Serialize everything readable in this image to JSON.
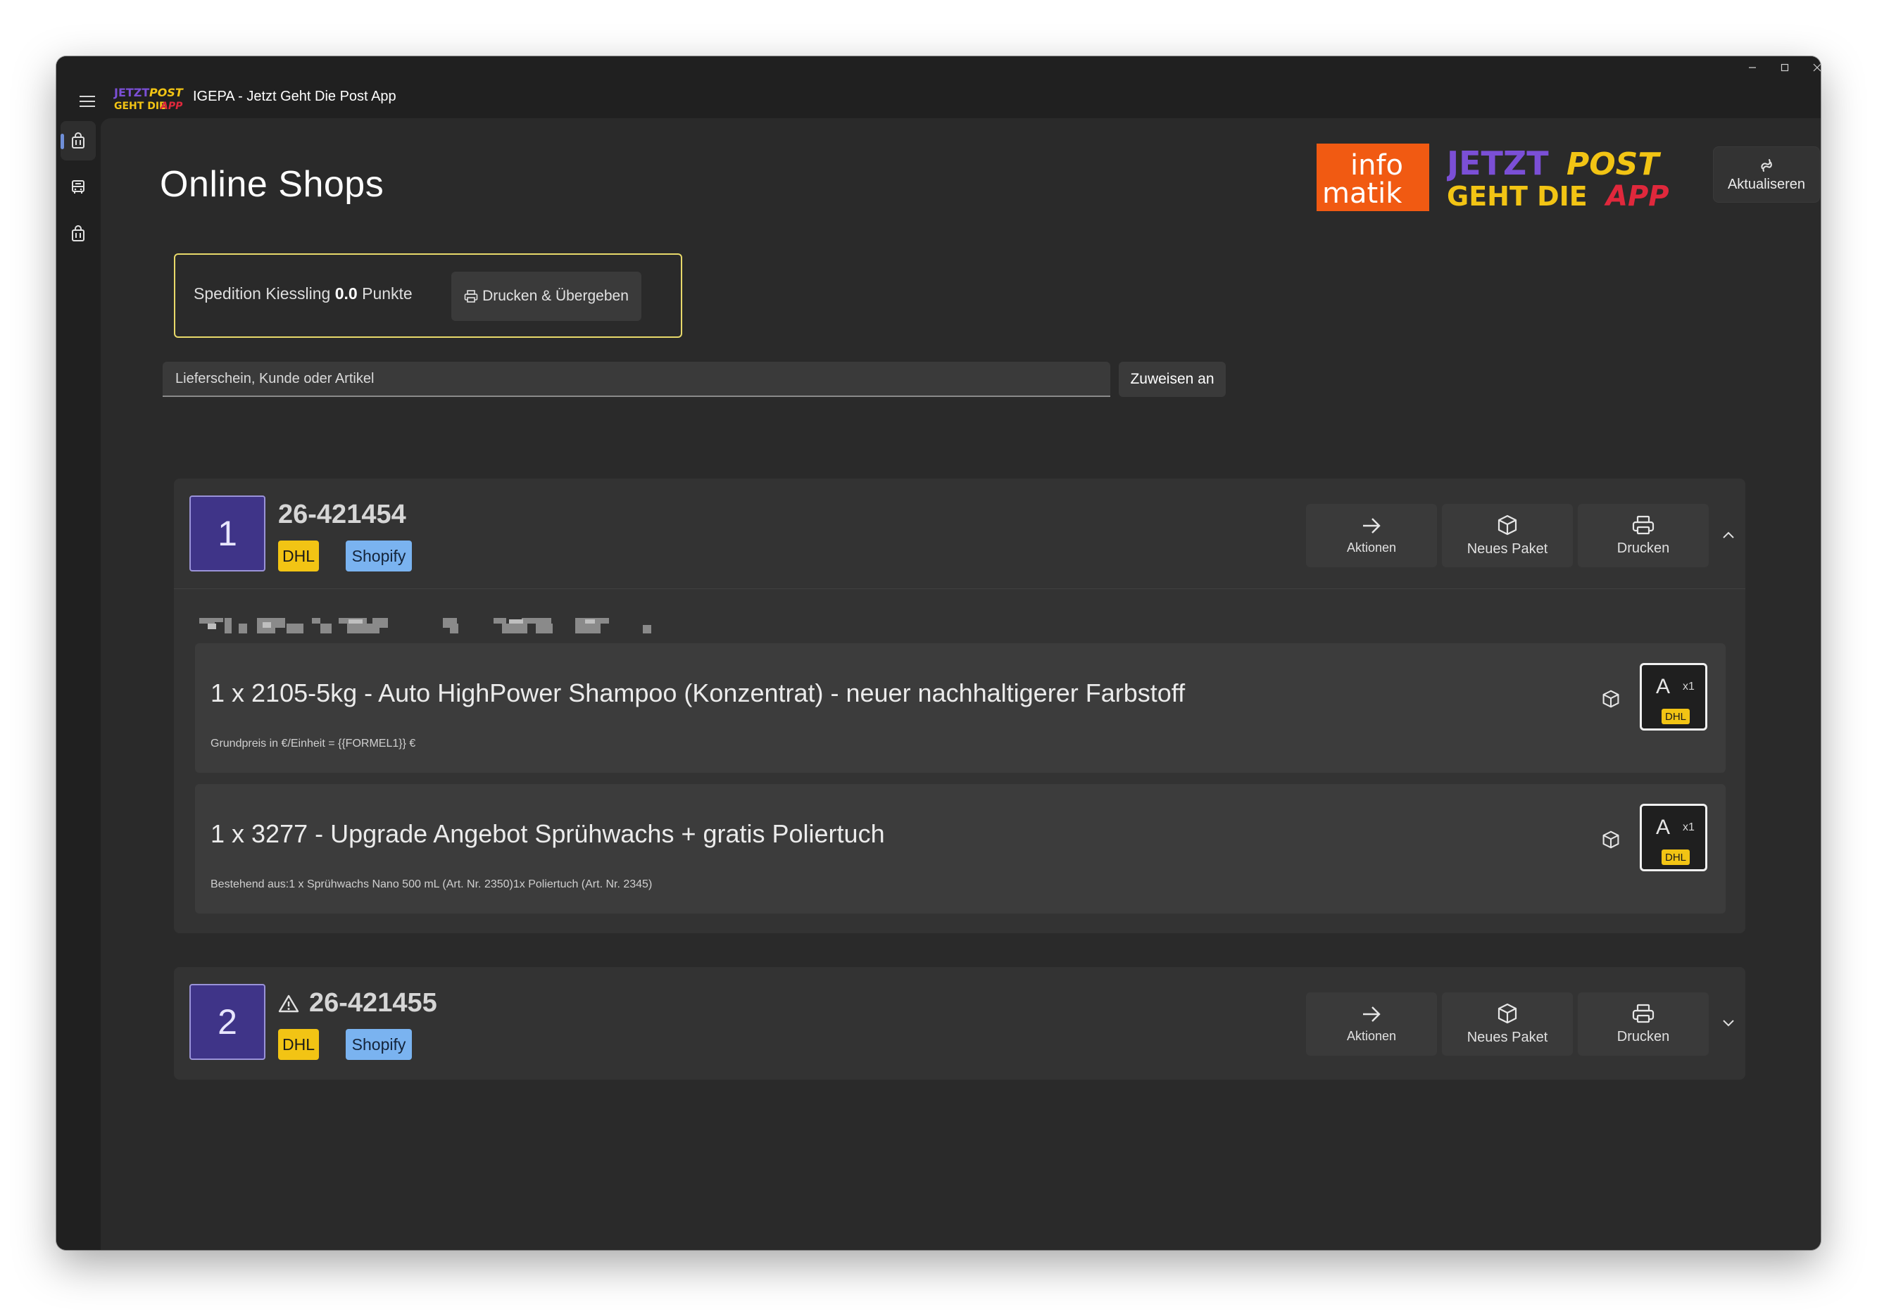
{
  "window": {
    "title": "IGEPA - Jetzt Geht Die Post App"
  },
  "header": {
    "page_title": "Online Shops",
    "refresh_label": "Aktualiseren"
  },
  "logos": {
    "small": [
      "JETZT",
      "POST",
      "GEHT DIE",
      "APP"
    ],
    "infomatik": [
      "info",
      "matik"
    ],
    "large": [
      "JETZT",
      "POST",
      "GEHT DIE",
      "APP"
    ]
  },
  "carrier_panel": {
    "name": "Spedition Kiessling",
    "points": "0.0",
    "points_label": "Punkte",
    "print_handover_label": "Drucken & Übergeben"
  },
  "search": {
    "placeholder": "Lieferschein, Kunde oder Artikel",
    "value": "",
    "assign_label": "Zuweisen an"
  },
  "actions": {
    "actions_label": "Aktionen",
    "new_package_label": "Neues Paket",
    "print_label": "Drucken"
  },
  "orders": [
    {
      "index": "1",
      "id": "26-421454",
      "warning": false,
      "carrier": "DHL",
      "platform": "Shopify",
      "expanded": true,
      "items": [
        {
          "title": "1 x 2105-5kg - Auto HighPower Shampoo (Konzentrat) - neuer nachhaltigerer Farbstoff",
          "subtitle": "Grundpreis in €/Einheit = {{FORMEL1}} €",
          "package_letter": "A",
          "package_qty": "x1",
          "package_carrier": "DHL"
        },
        {
          "title": "1 x 3277 - Upgrade Angebot Sprühwachs + gratis Poliertuch",
          "subtitle": "Bestehend aus:1 x Sprühwachs Nano 500 mL (Art. Nr. 2350)1x Poliertuch (Art. Nr. 2345)",
          "package_letter": "A",
          "package_qty": "x1",
          "package_carrier": "DHL"
        }
      ]
    },
    {
      "index": "2",
      "id": "26-421455",
      "warning": true,
      "carrier": "DHL",
      "platform": "Shopify",
      "expanded": false
    }
  ],
  "colors": {
    "accent_yellow": "#f2c414",
    "shopify_blue": "#7ab3f0",
    "order_purple": "#3f3488",
    "carrier_border": "#e8d96a",
    "infomatik_orange": "#f15a12",
    "logo_purple": "#7b4fd6",
    "logo_red": "#e0283c"
  },
  "icons": {
    "menu": "hamburger-icon",
    "nav": [
      "shopping-bag-icon",
      "truck-icon",
      "shopping-bag-icon",
      "toolbox-icon"
    ],
    "refresh": "refresh-icon",
    "print": "printer-icon",
    "actions": "arrow-right-icon",
    "new_package": "package-icon",
    "warning": "warning-triangle-icon"
  }
}
